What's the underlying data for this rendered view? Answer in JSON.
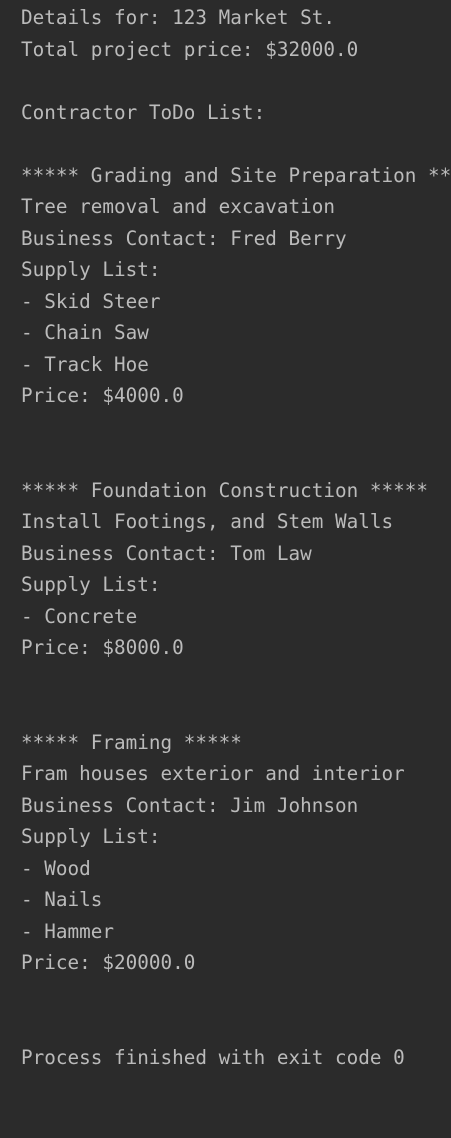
{
  "output": {
    "header": {
      "details": "Details for: 123 Market St.",
      "total_price": "Total project price: $32000.0"
    },
    "todo_title": "Contractor ToDo List:",
    "tasks": [
      {
        "heading": "***** Grading and Site Preparation *****",
        "description": "Tree removal and excavation",
        "contact": "Business Contact: Fred Berry",
        "supply_label": "Supply List:",
        "supplies": [
          "- Skid Steer",
          "- Chain Saw",
          "- Track Hoe"
        ],
        "price": "Price: $4000.0"
      },
      {
        "heading": "***** Foundation Construction *****",
        "description": "Install Footings, and Stem Walls",
        "contact": "Business Contact: Tom Law",
        "supply_label": "Supply List:",
        "supplies": [
          "- Concrete"
        ],
        "price": "Price: $8000.0"
      },
      {
        "heading": "***** Framing *****",
        "description": "Fram houses exterior and interior",
        "contact": "Business Contact: Jim Johnson",
        "supply_label": "Supply List:",
        "supplies": [
          "- Wood",
          "- Nails",
          "- Hammer"
        ],
        "price": "Price: $20000.0"
      }
    ],
    "exit_message": "Process finished with exit code 0"
  }
}
